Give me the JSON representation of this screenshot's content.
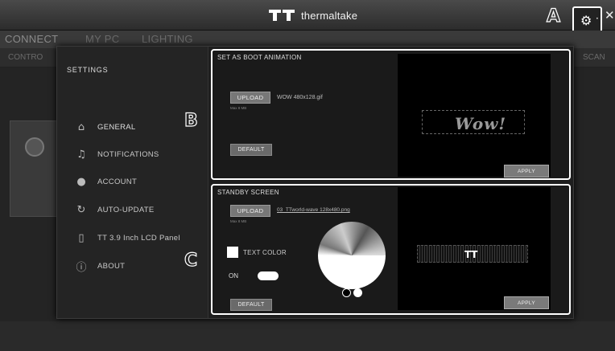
{
  "app": {
    "brand": "thermaltake"
  },
  "callouts": {
    "a": "A",
    "b": "B",
    "c": "C"
  },
  "nav": {
    "tabs": [
      "CONNECT",
      "MY PC",
      "LIGHTING"
    ],
    "sub_left": "CONTRO",
    "sub_right": "SCAN"
  },
  "sidebar": {
    "title": "SETTINGS",
    "items": [
      {
        "label": "GENERAL",
        "icon": "home-icon"
      },
      {
        "label": "NOTIFICATIONS",
        "icon": "bell-icon"
      },
      {
        "label": "ACCOUNT",
        "icon": "user-icon"
      },
      {
        "label": "AUTO-UPDATE",
        "icon": "refresh-icon"
      },
      {
        "label": "TT 3.9 Inch LCD Panel",
        "icon": "phone-icon"
      },
      {
        "label": "ABOUT",
        "icon": "info-icon"
      }
    ]
  },
  "boot": {
    "title": "SET AS BOOT ANIMATION",
    "upload_label": "UPLOAD",
    "file_name": "WOW 480x128.gif",
    "hint": "Max 8 MB",
    "default_label": "DEFAULT",
    "apply_label": "APPLY",
    "preview_text": "Wow!"
  },
  "standby": {
    "title": "STANDBY SCREEN",
    "upload_label": "UPLOAD",
    "file_name": "03_TTworld-wave 128x480.png",
    "hint": "Max 8 MB",
    "text_color_label": "TEXT COLOR",
    "on_label": "ON",
    "toggle_on": true,
    "default_label": "DEFAULT",
    "apply_label": "APPLY"
  },
  "colors": {
    "accent_border": "#ffffff",
    "panel_bg": "#1a1a1a",
    "button": "#777777"
  }
}
